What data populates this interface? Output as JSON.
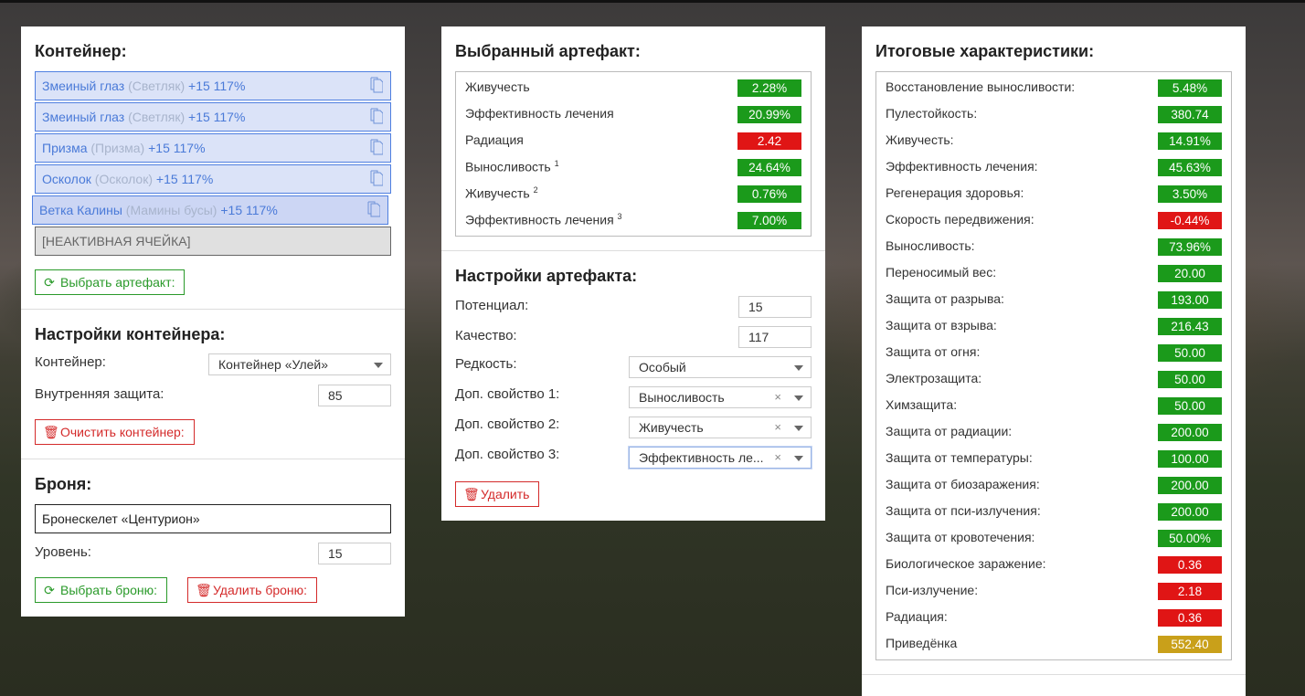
{
  "colors": {
    "positive": "#1b9a1b",
    "negative": "#e01515",
    "neutral": "#c9a01a",
    "slot_border": "#4f7fe0",
    "slot_bg": "#dbe3f8"
  },
  "container": {
    "title": "Контейнер:",
    "slots": [
      {
        "name": "Змеиный глаз",
        "type": "(Светляк)",
        "bonus": "+15 117%"
      },
      {
        "name": "Змеиный глаз",
        "type": "(Светляк)",
        "bonus": "+15 117%"
      },
      {
        "name": "Призма",
        "type": "(Призма)",
        "bonus": "+15 117%"
      },
      {
        "name": "Осколок",
        "type": "(Осколок)",
        "bonus": "+15 117%"
      },
      {
        "name": "Ветка Калины",
        "type": "(Мамины бусы)",
        "bonus": "+15 117%"
      }
    ],
    "inactive_slot": "[НЕАКТИВНАЯ ЯЧЕЙКА]",
    "select_button": "Выбрать артефакт:"
  },
  "container_settings": {
    "title": "Настройки контейнера:",
    "container_label": "Контейнер:",
    "container_value": "Контейнер «Улей»",
    "protection_label": "Внутренняя защита:",
    "protection_value": "85",
    "clear_button": "Очистить контейнер:"
  },
  "armor": {
    "title": "Броня:",
    "value": "Бронескелет «Центурион»",
    "level_label": "Уровень:",
    "level_value": "15",
    "select_button": "Выбрать броню:",
    "delete_button": "Удалить броню:"
  },
  "selected_artifact": {
    "title": "Выбранный артефакт:",
    "stats": [
      {
        "name": "Живучесть",
        "sup": "",
        "value": "2.28%",
        "status": "g"
      },
      {
        "name": "Эффективность лечения",
        "sup": "",
        "value": "20.99%",
        "status": "g"
      },
      {
        "name": "Радиация",
        "sup": "",
        "value": "2.42",
        "status": "r"
      },
      {
        "name": "Выносливость",
        "sup": "1",
        "value": "24.64%",
        "status": "g"
      },
      {
        "name": "Живучесть",
        "sup": "2",
        "value": "0.76%",
        "status": "g"
      },
      {
        "name": "Эффективность лечения",
        "sup": "3",
        "value": "7.00%",
        "status": "g"
      }
    ]
  },
  "artifact_settings": {
    "title": "Настройки артефакта:",
    "potential_label": "Потенциал:",
    "potential_value": "15",
    "quality_label": "Качество:",
    "quality_value": "117",
    "rarity_label": "Редкость:",
    "rarity_value": "Особый",
    "extra1_label": "Доп. свойство 1:",
    "extra1_value": "Выносливость",
    "extra2_label": "Доп. свойство 2:",
    "extra2_value": "Живучесть",
    "extra3_label": "Доп. свойство 3:",
    "extra3_value": "Эффективность ле...",
    "delete_button": "Удалить"
  },
  "totals": {
    "title": "Итоговые характеристики:",
    "stats": [
      {
        "name": "Восстановление выносливости:",
        "value": "5.48%",
        "status": "g"
      },
      {
        "name": "Пулестойкость:",
        "value": "380.74",
        "status": "g"
      },
      {
        "name": "Живучесть:",
        "value": "14.91%",
        "status": "g"
      },
      {
        "name": "Эффективность лечения:",
        "value": "45.63%",
        "status": "g"
      },
      {
        "name": "Регенерация здоровья:",
        "value": "3.50%",
        "status": "g"
      },
      {
        "name": "Скорость передвижения:",
        "value": "-0.44%",
        "status": "r"
      },
      {
        "name": "Выносливость:",
        "value": "73.96%",
        "status": "g"
      },
      {
        "name": "Переносимый вес:",
        "value": "20.00",
        "status": "g"
      },
      {
        "name": "Защита от разрыва:",
        "value": "193.00",
        "status": "g"
      },
      {
        "name": "Защита от взрыва:",
        "value": "216.43",
        "status": "g"
      },
      {
        "name": "Защита от огня:",
        "value": "50.00",
        "status": "g"
      },
      {
        "name": "Электрозащита:",
        "value": "50.00",
        "status": "g"
      },
      {
        "name": "Химзащита:",
        "value": "50.00",
        "status": "g"
      },
      {
        "name": "Защита от радиации:",
        "value": "200.00",
        "status": "g"
      },
      {
        "name": "Защита от температуры:",
        "value": "100.00",
        "status": "g"
      },
      {
        "name": "Защита от биозаражения:",
        "value": "200.00",
        "status": "g"
      },
      {
        "name": "Защита от пси-излучения:",
        "value": "200.00",
        "status": "g"
      },
      {
        "name": "Защита от кровотечения:",
        "value": "50.00%",
        "status": "g"
      },
      {
        "name": "Биологическое заражение:",
        "value": "0.36",
        "status": "r"
      },
      {
        "name": "Пси-излучение:",
        "value": "2.18",
        "status": "r"
      },
      {
        "name": "Радиация:",
        "value": "0.36",
        "status": "r"
      },
      {
        "name": "Приведёнка",
        "value": "552.40",
        "status": "y"
      }
    ]
  }
}
